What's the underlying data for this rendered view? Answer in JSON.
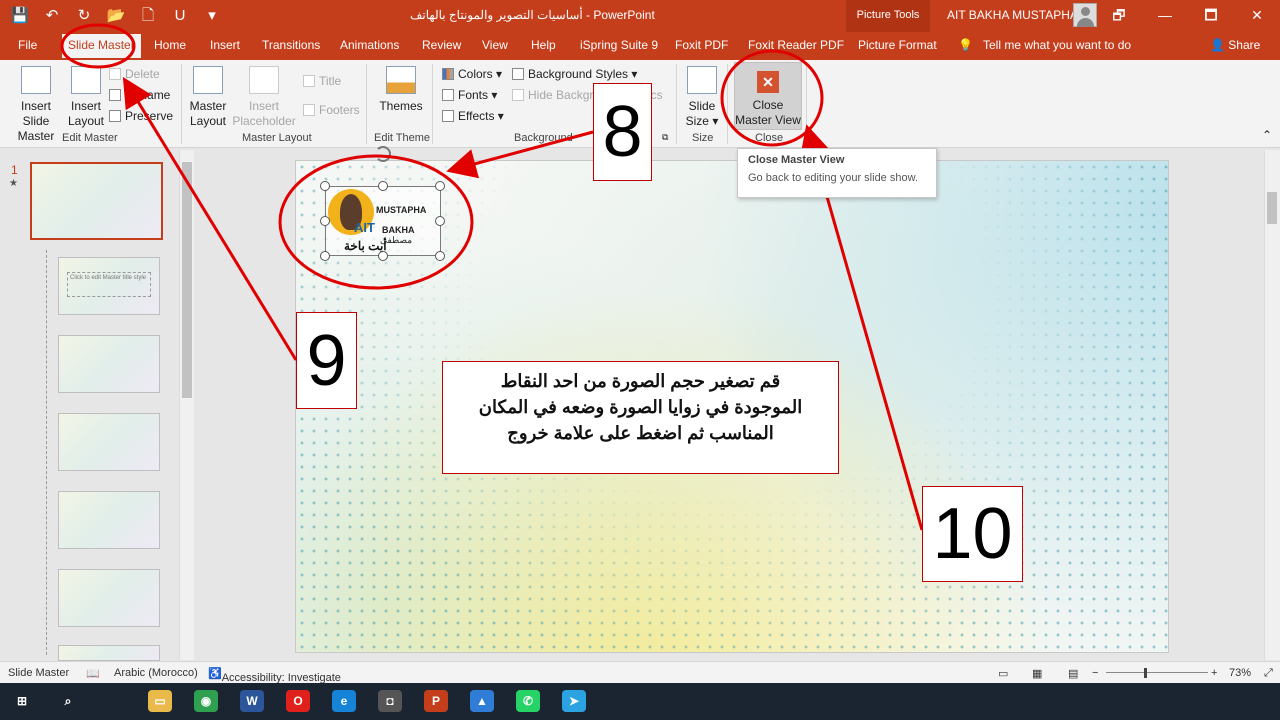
{
  "titlebar": {
    "doc_title": "أساسيات التصوير والمونتاج بالهاتف  -  PowerPoint",
    "context_tab": "Picture Tools",
    "user": "AIT BAKHA MUSTAPHA",
    "qat": [
      "💾",
      "↶",
      "↻",
      "📂",
      "🗋",
      "U",
      "▾"
    ],
    "win": [
      "🗗",
      "—",
      "🗖",
      "✕"
    ]
  },
  "tabs": [
    "File",
    "Slide Master",
    "Home",
    "Insert",
    "Transitions",
    "Animations",
    "Review",
    "View",
    "Help",
    "iSpring Suite 9",
    "Foxit PDF",
    "Foxit Reader PDF",
    "Picture Format"
  ],
  "tell_me": "Tell me what you want to do",
  "share": "Share",
  "ribbon": {
    "edit_master": {
      "insert_slide": "Insert Slide",
      "insert_slide2": "Master",
      "insert_layout": "Insert",
      "insert_layout2": "Layout",
      "delete": "Delete",
      "rename": "Rename",
      "preserve": "Preserve",
      "label": "Edit Master"
    },
    "master_layout": {
      "master_layout": "Master",
      "master_layout2": "Layout",
      "insert_ph": "Insert",
      "insert_ph2": "Placeholder",
      "title": "Title",
      "footers": "Footers",
      "label": "Master Layout"
    },
    "edit_theme": {
      "themes": "Themes",
      "label": "Edit Theme"
    },
    "background": {
      "colors": "Colors",
      "fonts": "Fonts",
      "effects": "Effects",
      "bg_styles": "Background Styles",
      "hide_bg": "Hide Backgro",
      "graphics_tail": "ics",
      "label": "Background"
    },
    "size": {
      "slide_size": "Slide",
      "slide_size2": "Size",
      "label": "Size"
    },
    "close": {
      "close_master": "Close",
      "close_master2": "Master View",
      "label": "Close"
    }
  },
  "tooltip": {
    "title": "Close Master View",
    "body": "Go back to editing your slide show."
  },
  "thumbs": {
    "num": "1",
    "star": "★",
    "text": "Click to edit Master title style"
  },
  "logo": {
    "l1": "MUSTAPHA",
    "l2": "AIT",
    "l3": "BAKHA",
    "l4": "مصطفى",
    "l5": "أيت باخة"
  },
  "instruction": "قم تصغير حجم الصورة من احد النقاط الموجودة في زوايا الصورة وضعه في المكان المناسب ثم اضغط على علامة خروج",
  "annotations": {
    "n8": "8",
    "n9": "9",
    "n10": "10"
  },
  "status": {
    "view": "Slide Master",
    "lang": "Arabic (Morocco)",
    "access": "Accessibility: Investigate",
    "zoom": "73%"
  },
  "taskbar": [
    {
      "name": "windows",
      "glyph": "⊞",
      "color": "#1b2532"
    },
    {
      "name": "search",
      "glyph": "⌕",
      "color": "#1b2532"
    },
    {
      "name": "file-explorer",
      "glyph": "▭",
      "color": "#e9b949"
    },
    {
      "name": "chrome",
      "glyph": "◉",
      "color": "#2fa04f"
    },
    {
      "name": "word",
      "glyph": "W",
      "color": "#2b579a"
    },
    {
      "name": "opera",
      "glyph": "O",
      "color": "#e0201b"
    },
    {
      "name": "edge",
      "glyph": "e",
      "color": "#1584d6"
    },
    {
      "name": "camera",
      "glyph": "◘",
      "color": "#555"
    },
    {
      "name": "powerpoint",
      "glyph": "P",
      "color": "#c43e1c"
    },
    {
      "name": "photos",
      "glyph": "▲",
      "color": "#2f7dd6"
    },
    {
      "name": "whatsapp",
      "glyph": "✆",
      "color": "#25d366"
    },
    {
      "name": "telegram",
      "glyph": "➤",
      "color": "#2aa3e0"
    }
  ],
  "colors": {
    "accent": "#c43e1c",
    "annotation_red": "#e00000"
  }
}
